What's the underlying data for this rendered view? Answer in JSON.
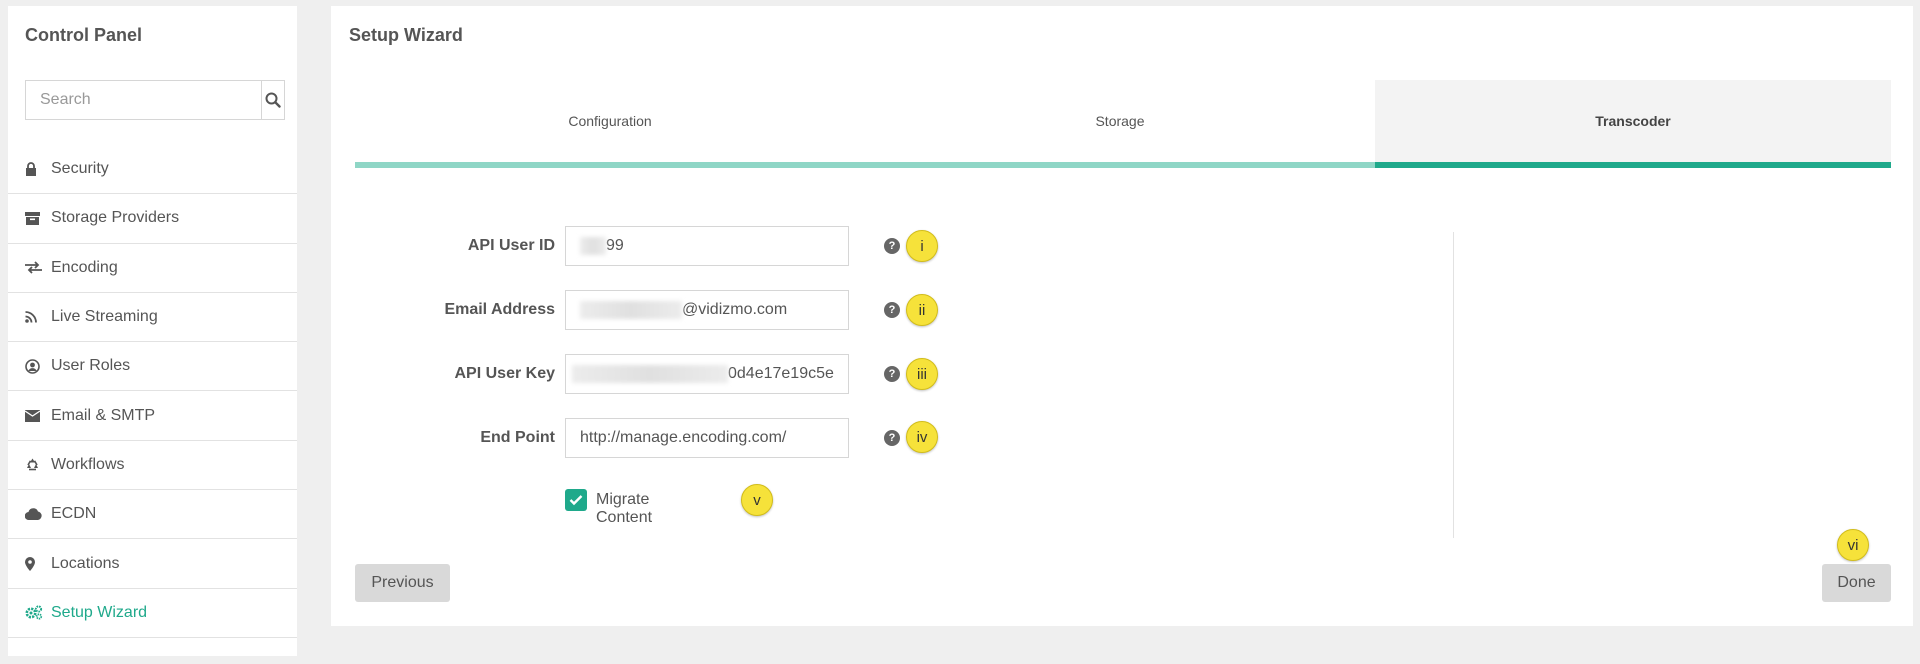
{
  "sidebar": {
    "title": "Control Panel",
    "search_placeholder": "Search",
    "items": [
      {
        "label": "Security",
        "icon": "lock-icon"
      },
      {
        "label": "Storage Providers",
        "icon": "archive-icon"
      },
      {
        "label": "Encoding",
        "icon": "exchange-icon"
      },
      {
        "label": "Live Streaming",
        "icon": "rss-icon"
      },
      {
        "label": "User Roles",
        "icon": "user-circle-icon"
      },
      {
        "label": "Email & SMTP",
        "icon": "envelope-icon"
      },
      {
        "label": "Workflows",
        "icon": "recycle-icon"
      },
      {
        "label": "ECDN",
        "icon": "cloud-icon"
      },
      {
        "label": "Locations",
        "icon": "map-marker-icon"
      },
      {
        "label": "Setup Wizard",
        "icon": "cogs-icon",
        "active": true
      }
    ]
  },
  "main": {
    "title": "Setup Wizard",
    "tabs": [
      {
        "label": "Configuration"
      },
      {
        "label": "Storage"
      },
      {
        "label": "Transcoder",
        "active": true
      }
    ],
    "form": {
      "api_user_id": {
        "label": "API User ID",
        "value": "99",
        "badge": "i"
      },
      "email": {
        "label": "Email Address",
        "value": "@vidizmo.com",
        "badge": "ii"
      },
      "api_user_key": {
        "label": "API User Key",
        "value": "0d4e17e19c5e",
        "badge": "iii"
      },
      "end_point": {
        "label": "End Point",
        "value": "http://manage.encoding.com/",
        "badge": "iv"
      },
      "migrate": {
        "label": "Migrate Content",
        "checked": true,
        "badge": "v"
      }
    },
    "buttons": {
      "previous": "Previous",
      "done": "Done",
      "done_badge": "vi"
    }
  },
  "colors": {
    "accent": "#1fa98b",
    "accent_light": "#8fd6c6",
    "badge": "#f6e23a"
  }
}
